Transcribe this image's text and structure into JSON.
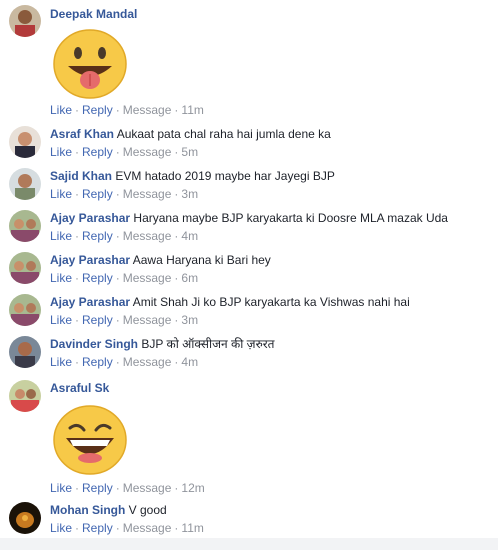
{
  "actions": {
    "like": "Like",
    "reply": "Reply",
    "message": "Message",
    "dot": "·"
  },
  "comments": [
    {
      "name": "Deepak Mandal",
      "text": "",
      "time": "11m",
      "sticker": "tongue-out-emoji"
    },
    {
      "name": "Asraf Khan",
      "text": "Aukaat pata chal raha hai jumla dene ka",
      "time": "5m"
    },
    {
      "name": "Sajid Khan",
      "text": "EVM hatado 2019 maybe har Jayegi BJP",
      "time": "3m"
    },
    {
      "name": "Ajay Parashar",
      "text": "Haryana maybe BJP karyakarta ki Doosre MLA mazak Uda",
      "time": "4m"
    },
    {
      "name": "Ajay Parashar",
      "text": "Aawa Haryana ki Bari hey",
      "time": "6m"
    },
    {
      "name": "Ajay Parashar",
      "text": "Amit Shah Ji ko BJP karyakarta ka Vishwas nahi hai",
      "time": "3m"
    },
    {
      "name": "Davinder Singh",
      "text": "BJP को ऑक्सीजन की ज़रुरत",
      "time": "4m"
    },
    {
      "name": "Asraful Sk",
      "text": "",
      "time": "12m",
      "sticker": "laughing-emoji"
    },
    {
      "name": "Mohan Singh",
      "text": "V good",
      "time": "11m"
    }
  ],
  "colors": {
    "name": "#365899",
    "link": "#4267b2",
    "meta": "#90949c",
    "emoji": "#f7c948"
  }
}
